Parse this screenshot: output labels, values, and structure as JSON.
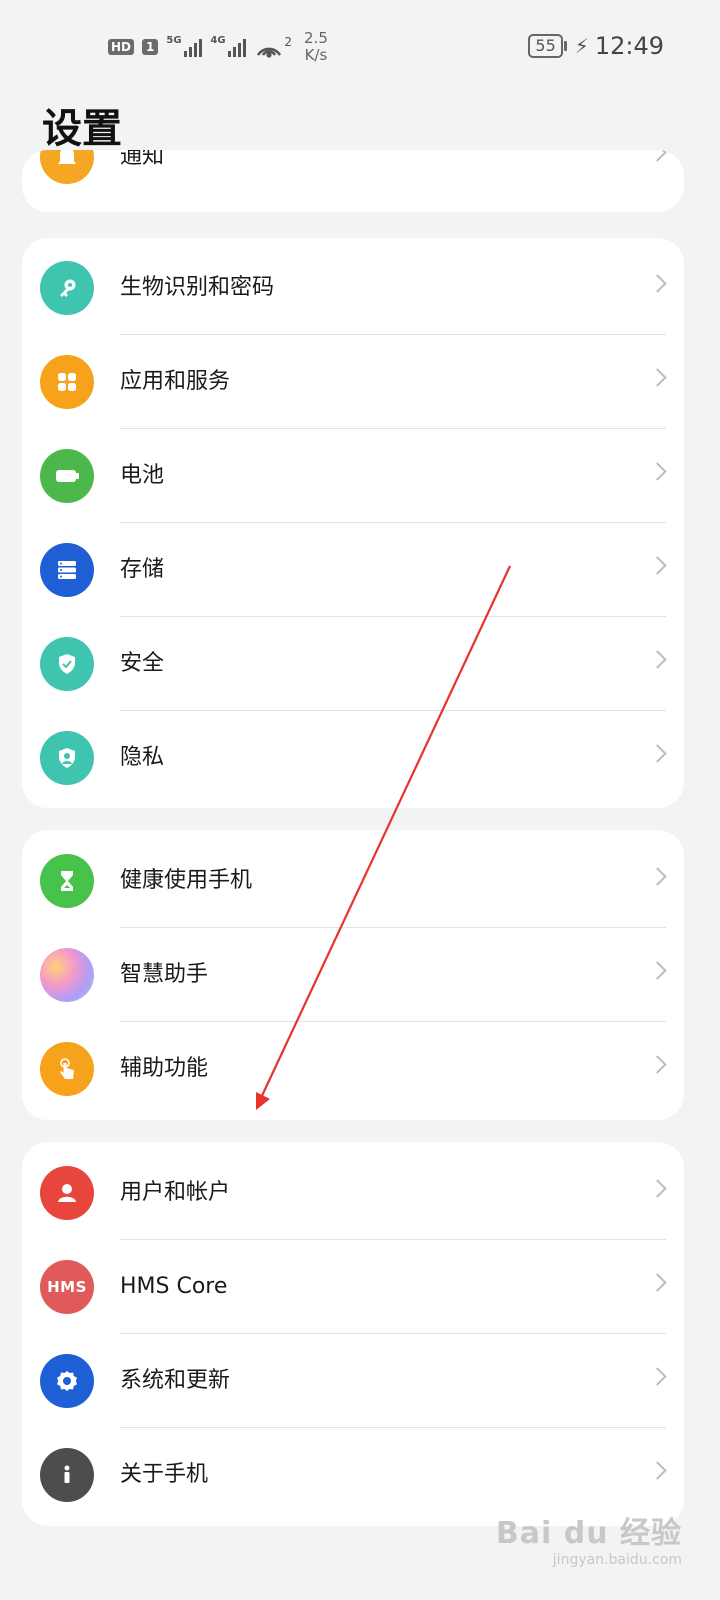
{
  "status_bar": {
    "hd": "HD",
    "sim": "1",
    "network_1": "5G",
    "network_2": "4G",
    "hotspot_count": "2",
    "speed_value": "2.5",
    "speed_unit": "K/s",
    "battery": "55",
    "time": "12:49"
  },
  "header": {
    "title": "设置"
  },
  "groups": [
    {
      "items": [
        {
          "label": "通知",
          "icon": "bell-icon",
          "color": "#f5a623"
        }
      ]
    },
    {
      "items": [
        {
          "label": "生物识别和密码",
          "icon": "key-icon",
          "color": "#3fc4b0"
        },
        {
          "label": "应用和服务",
          "icon": "apps-icon",
          "color": "#f7a21b"
        },
        {
          "label": "电池",
          "icon": "battery-icon",
          "color": "#4cb84c"
        },
        {
          "label": "存储",
          "icon": "storage-icon",
          "color": "#1f5fd6"
        },
        {
          "label": "安全",
          "icon": "shield-icon",
          "color": "#3fc4b0"
        },
        {
          "label": "隐私",
          "icon": "privacy-icon",
          "color": "#3fc4b0"
        }
      ]
    },
    {
      "items": [
        {
          "label": "健康使用手机",
          "icon": "hourglass-icon",
          "color": "#47c24a"
        },
        {
          "label": "智慧助手",
          "icon": "assistant-icon",
          "color": "#c89cf0"
        },
        {
          "label": "辅助功能",
          "icon": "hand-touch-icon",
          "color": "#f7a21b"
        }
      ]
    },
    {
      "items": [
        {
          "label": "用户和帐户",
          "icon": "user-icon",
          "color": "#e8453c"
        },
        {
          "label": "HMS Core",
          "icon": "hms-icon",
          "color": "#e05a5a",
          "icon_text": "HMS"
        },
        {
          "label": "系统和更新",
          "icon": "gear-icon",
          "color": "#1f5fd6"
        },
        {
          "label": "关于手机",
          "icon": "info-icon",
          "color": "#4d4d4d"
        }
      ]
    }
  ],
  "watermark": {
    "brand": "Bai du 经验",
    "url": "jingyan.baidu.com"
  },
  "annotation": {
    "color": "#e8322b"
  }
}
